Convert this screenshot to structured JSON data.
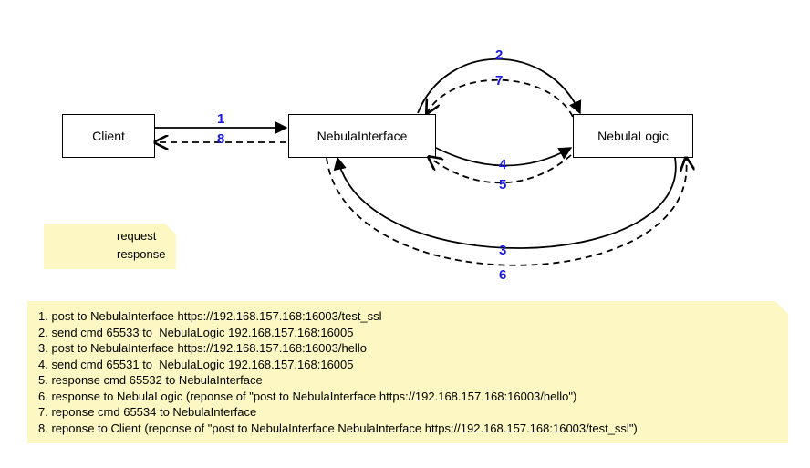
{
  "nodes": {
    "client": "Client",
    "interface": "NebulaInterface",
    "logic": "NebulaLogic"
  },
  "legend": {
    "request": "request",
    "response": "response"
  },
  "edge_labels": {
    "n1": "1",
    "n2": "2",
    "n3": "3",
    "n4": "4",
    "n5": "5",
    "n6": "6",
    "n7": "7",
    "n8": "8"
  },
  "steps": [
    "1. post to NebulaInterface https://192.168.157.168:16003/test_ssl",
    "2. send cmd 65533 to  NebulaLogic 192.168.157.168:16005",
    "3. post to NebulaInterface https://192.168.157.168:16003/hello",
    "4. send cmd 65531 to  NebulaLogic 192.168.157.168:16005",
    "5. response cmd 65532 to NebulaInterface",
    "6. response to NebulaLogic (reponse of \"post to NebulaInterface https://192.168.157.168:16003/hello\")",
    "7. reponse cmd 65534 to NebulaInterface",
    "8. reponse to Client (reponse of \"post to NebulaInterface NebulaInterface https://192.168.157.168:16003/test_ssl\")"
  ],
  "diagram_data": {
    "type": "graph",
    "nodes": [
      "Client",
      "NebulaInterface",
      "NebulaLogic"
    ],
    "edges": [
      {
        "n": 1,
        "from": "Client",
        "to": "NebulaInterface",
        "style": "solid",
        "kind": "request"
      },
      {
        "n": 2,
        "from": "NebulaInterface",
        "to": "NebulaLogic",
        "style": "solid",
        "kind": "request",
        "curve": "top-outer"
      },
      {
        "n": 3,
        "from": "NebulaLogic",
        "to": "NebulaInterface",
        "style": "solid",
        "kind": "request",
        "curve": "bottom-outer"
      },
      {
        "n": 4,
        "from": "NebulaInterface",
        "to": "NebulaLogic",
        "style": "solid",
        "kind": "request",
        "curve": "mid"
      },
      {
        "n": 5,
        "from": "NebulaLogic",
        "to": "NebulaInterface",
        "style": "dashed",
        "kind": "response",
        "curve": "mid"
      },
      {
        "n": 6,
        "from": "NebulaInterface",
        "to": "NebulaLogic",
        "style": "dashed",
        "kind": "response",
        "curve": "bottom-outer"
      },
      {
        "n": 7,
        "from": "NebulaLogic",
        "to": "NebulaInterface",
        "style": "dashed",
        "kind": "response",
        "curve": "top-inner"
      },
      {
        "n": 8,
        "from": "NebulaInterface",
        "to": "Client",
        "style": "dashed",
        "kind": "response"
      }
    ]
  }
}
